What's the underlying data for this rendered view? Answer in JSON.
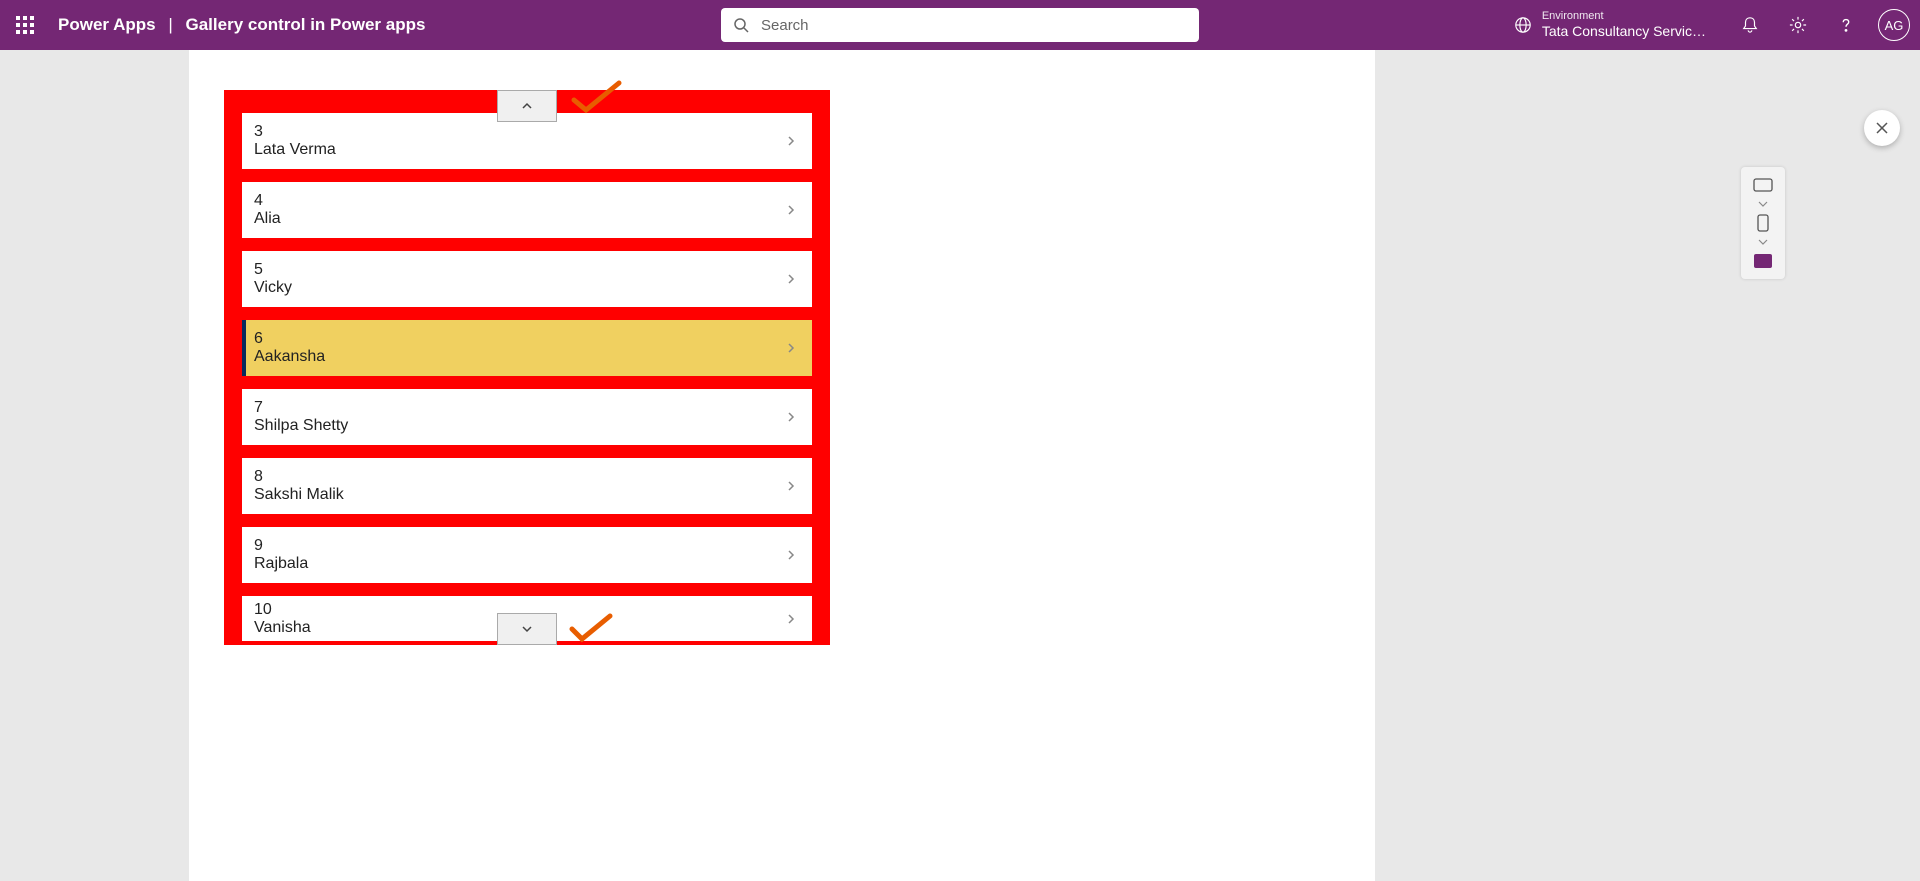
{
  "header": {
    "app_name": "Power Apps",
    "page_title": "Gallery control in Power apps",
    "search_placeholder": "Search",
    "env_label": "Environment",
    "env_name": "Tata Consultancy Servic…",
    "avatar_initials": "AG"
  },
  "gallery": {
    "items": [
      {
        "id": "3",
        "name": "Lata Verma",
        "selected": false
      },
      {
        "id": "4",
        "name": "Alia",
        "selected": false
      },
      {
        "id": "5",
        "name": "Vicky",
        "selected": false
      },
      {
        "id": "6",
        "name": "Aakansha",
        "selected": true
      },
      {
        "id": "7",
        "name": "Shilpa Shetty",
        "selected": false
      },
      {
        "id": "8",
        "name": "Sakshi Malik",
        "selected": false
      },
      {
        "id": "9",
        "name": "Rajbala",
        "selected": false
      },
      {
        "id": "10",
        "name": "Vanisha",
        "selected": false
      }
    ]
  }
}
